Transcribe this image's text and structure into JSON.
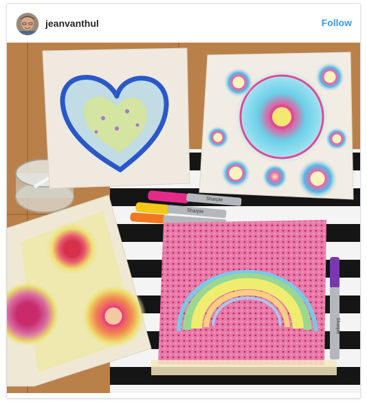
{
  "post": {
    "username": "jeanvanthul",
    "follow_label": "Follow"
  },
  "photo": {
    "alt": "Sharpie tie-dye paper towel art: heart, circles, sun bursts and rainbow"
  },
  "colors": {
    "follow_blue": "#3897f0",
    "username_text": "#262626",
    "table_wood": "#b57b45"
  },
  "icons": {
    "avatar": "profile-photo"
  }
}
